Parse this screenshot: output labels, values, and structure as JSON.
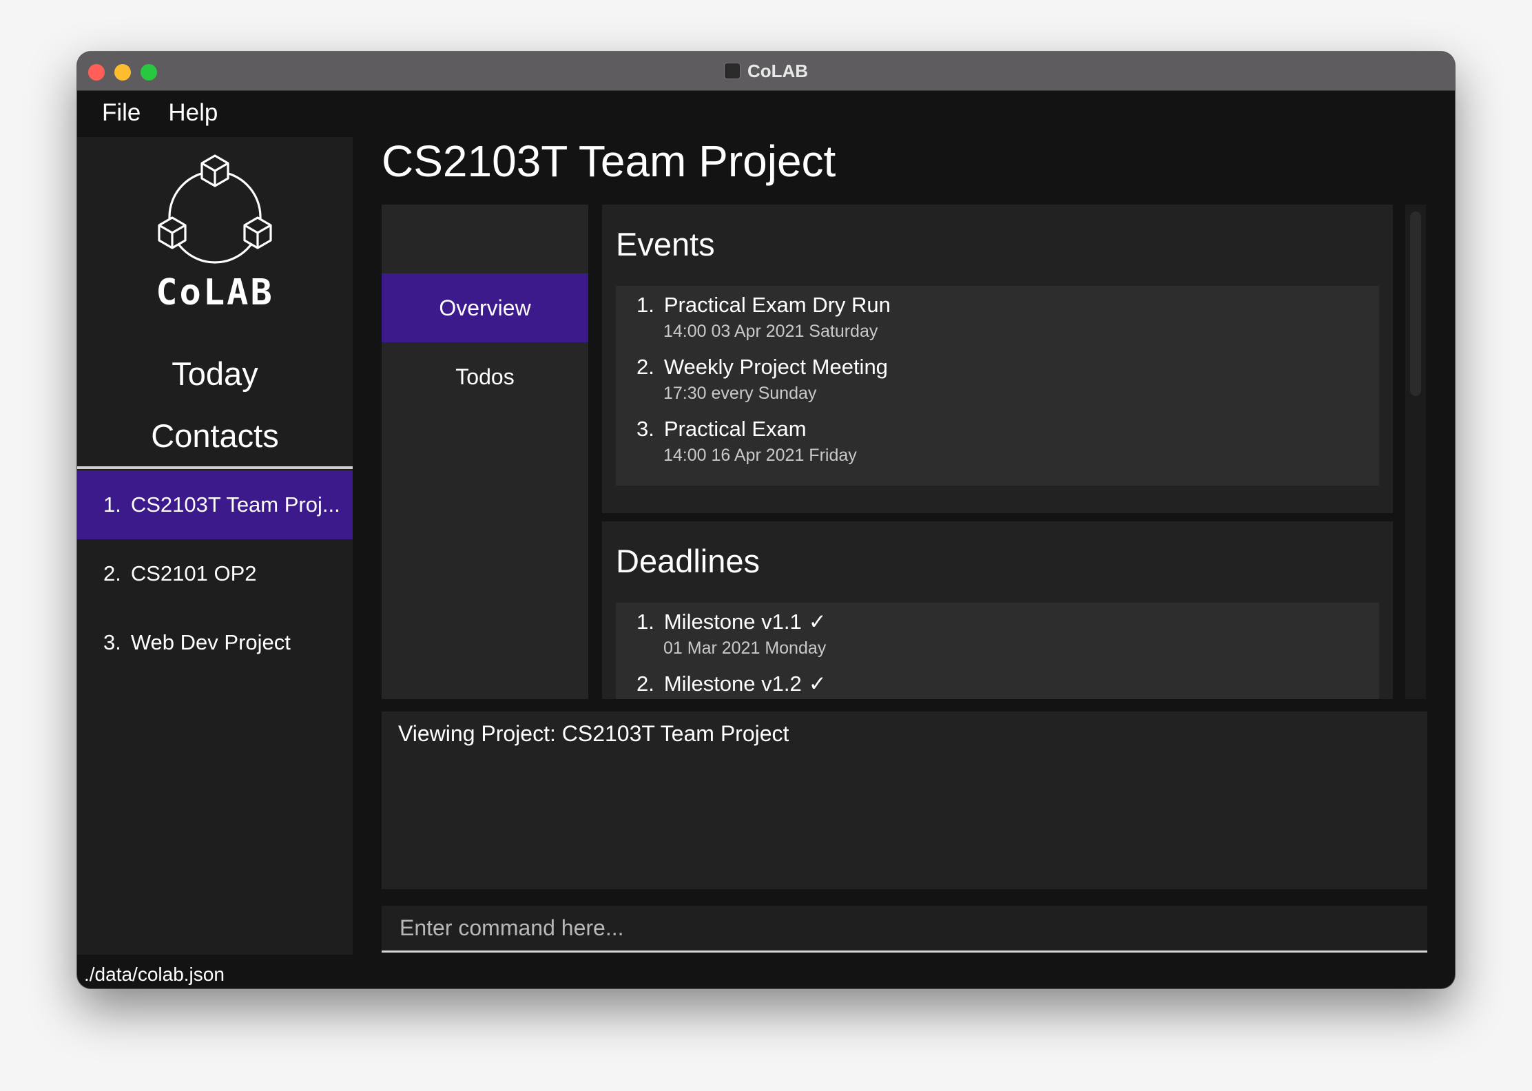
{
  "window": {
    "title": "CoLAB"
  },
  "menu": {
    "file": "File",
    "help": "Help"
  },
  "sidebar": {
    "logo_text": "CoLAB",
    "nav_today": "Today",
    "nav_contacts": "Contacts",
    "projects": [
      {
        "num": "1.",
        "name": "CS2103T Team Proj...",
        "selected": true
      },
      {
        "num": "2.",
        "name": "CS2101 OP2",
        "selected": false
      },
      {
        "num": "3.",
        "name": "Web Dev Project",
        "selected": false
      }
    ]
  },
  "main": {
    "title": "CS2103T Team Project",
    "tabs": [
      {
        "label": "Overview",
        "active": true
      },
      {
        "label": "Todos",
        "active": false
      }
    ],
    "events": {
      "heading": "Events",
      "items": [
        {
          "num": "1.",
          "name": "Practical Exam Dry Run",
          "detail": "14:00  03 Apr 2021  Saturday"
        },
        {
          "num": "2.",
          "name": "Weekly Project Meeting",
          "detail": "17:30  every  Sunday"
        },
        {
          "num": "3.",
          "name": "Practical Exam",
          "detail": "14:00  16 Apr 2021  Friday"
        }
      ]
    },
    "deadlines": {
      "heading": "Deadlines",
      "items": [
        {
          "num": "1.",
          "name": "Milestone v1.1",
          "check": "✓",
          "detail": "01 Mar 2021  Monday"
        },
        {
          "num": "2.",
          "name": "Milestone v1.2",
          "check": "✓",
          "detail": ""
        }
      ]
    },
    "result": "Viewing Project: CS2103T Team Project",
    "command": {
      "placeholder": "Enter command here...",
      "value": ""
    }
  },
  "status": {
    "path": "./data/colab.json"
  },
  "colors": {
    "accent": "#3d1a8c",
    "background": "#131313",
    "panel": "#222222"
  }
}
